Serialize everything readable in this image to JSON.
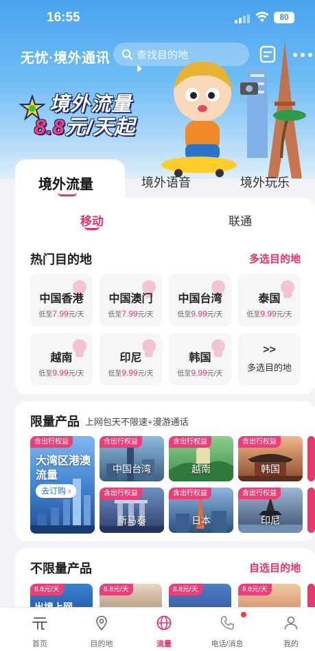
{
  "status_bar": {
    "time": "16:55",
    "battery": "80"
  },
  "header": {
    "app_title": "无忧·境外通讯",
    "search_placeholder": "查找目的地"
  },
  "banner": {
    "line1": "境外流量",
    "price": "8.8",
    "line2_suffix": "元/天起"
  },
  "main_tabs": [
    {
      "label": "境外流量",
      "active": true
    },
    {
      "label": "境外语音",
      "active": false
    },
    {
      "label": "境外玩乐",
      "active": false
    }
  ],
  "carrier_tabs": [
    {
      "label": "移动",
      "active": true
    },
    {
      "label": "联通",
      "active": false
    }
  ],
  "hot_destinations": {
    "title": "热门目的地",
    "more_link": "多选目的地",
    "price_prefix": "低至",
    "price_suffix": "元/天",
    "items": [
      {
        "name": "中国香港",
        "price": "7.99"
      },
      {
        "name": "中国澳门",
        "price": "7.99"
      },
      {
        "name": "中国台湾",
        "price": "9.99"
      },
      {
        "name": "泰国",
        "price": "9.99"
      },
      {
        "name": "越南",
        "price": "9.99"
      },
      {
        "name": "印尼",
        "price": "9.99"
      },
      {
        "name": "韩国",
        "price": "9.99"
      }
    ],
    "more_cell": {
      "arrows": ">>",
      "label": "多选目的地"
    }
  },
  "limited_products": {
    "title": "限量产品",
    "subtitle": "上网包天不限速+漫游通话",
    "tag": "含出行权益",
    "featured": {
      "title_line1": "大湾区港澳",
      "title_line2": "流量",
      "button": "去订购 ›"
    },
    "items": [
      {
        "label": "中国台湾"
      },
      {
        "label": "越南"
      },
      {
        "label": "韩国"
      },
      {
        "label": "新马泰"
      },
      {
        "label": "日本"
      },
      {
        "label": "印尼"
      }
    ]
  },
  "unlimited_products": {
    "title": "不限量产品",
    "more_link": "自选目的地",
    "tag": "8.8元/天",
    "first_label": "出境上网"
  },
  "bottom_nav": [
    {
      "label": "首页",
      "icon": "home-icon"
    },
    {
      "label": "目的地",
      "icon": "location-pin-icon"
    },
    {
      "label": "流量",
      "icon": "globe-icon",
      "active": true
    },
    {
      "label": "电话/消息",
      "icon": "phone-icon",
      "badge": true
    },
    {
      "label": "我的",
      "icon": "profile-icon"
    }
  ],
  "colors": {
    "accent": "#e8336a",
    "tag": "#ea3f78",
    "hero_sky": "#4aa3ef"
  }
}
